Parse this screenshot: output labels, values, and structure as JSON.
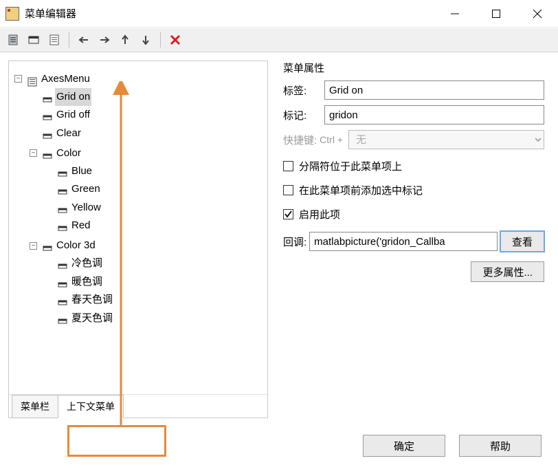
{
  "window": {
    "title": "菜单编辑器"
  },
  "toolbar": {
    "icons": [
      "new-menu",
      "new-context-menu",
      "new-item",
      "sep",
      "move-left",
      "move-right",
      "move-up",
      "move-down",
      "sep",
      "delete"
    ]
  },
  "tree": {
    "root": {
      "label": "AxesMenu",
      "children": [
        {
          "label": "Grid on",
          "selected": true
        },
        {
          "label": "Grid off"
        },
        {
          "label": "Clear"
        },
        {
          "label": "Color",
          "children": [
            {
              "label": "Blue"
            },
            {
              "label": "Green"
            },
            {
              "label": "Yellow"
            },
            {
              "label": "Red"
            }
          ]
        },
        {
          "label": "Color 3d",
          "children": [
            {
              "label": "冷色调"
            },
            {
              "label": "暖色调"
            },
            {
              "label": "春天色调"
            },
            {
              "label": "夏天色调"
            }
          ]
        }
      ]
    }
  },
  "tabs": {
    "tab1": "菜单栏",
    "tab2": "上下文菜单"
  },
  "props": {
    "header": "菜单属性",
    "tag_label": "标签:",
    "tag_value": "Grid on",
    "mark_label": "标记:",
    "mark_value": "gridon",
    "shortcut_label": "快捷键:",
    "shortcut_ctrl": "Ctrl +",
    "shortcut_value": "无",
    "sep_check": "分隔符位于此菜单项上",
    "addcheck_check": "在此菜单项前添加选中标记",
    "enable_check": "启用此项",
    "callback_label": "回调:",
    "callback_value": "matlabpicture('gridon_Callba",
    "view_btn": "查看",
    "more_btn": "更多属性..."
  },
  "footer": {
    "ok": "确定",
    "help": "帮助"
  }
}
